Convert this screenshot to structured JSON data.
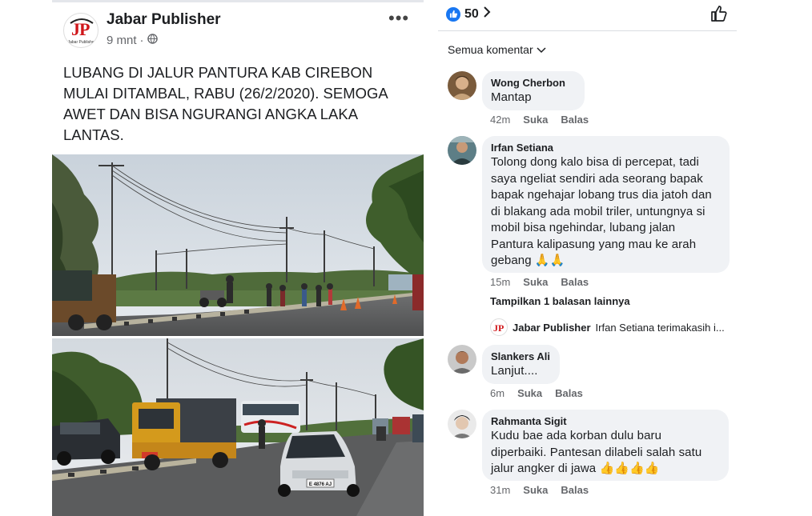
{
  "post": {
    "author": "Jabar Publisher",
    "time": "9 mnt",
    "logo_text": "JP",
    "logo_subtext": "Jabar Publisher",
    "privacy_icon": "globe-icon",
    "more_icon": "more-horizontal-icon",
    "text": "LUBANG DI JALUR PANTURA KAB CIREBON MULAI DITAMBAL, RABU (26/2/2020). SEMOGA AWET DAN BISA NGURANGI ANGKA LAKA LANTAS.",
    "photo2_plate": "E 4876 AJ"
  },
  "comments_panel": {
    "reaction_count": "50",
    "sort_label": "Semua komentar",
    "like_icon": "thumbs-up-icon",
    "accent": "#1877f2",
    "comments": [
      {
        "name": "Wong Cherbon",
        "text": "Mantap",
        "time": "42m",
        "like": "Suka",
        "reply": "Balas"
      },
      {
        "name": "Irfan Setiana",
        "text": "Tolong dong kalo bisa di percepat, tadi saya ngeliat sendiri ada seorang bapak bapak ngehajar lobang trus dia jatoh dan di blakang ada mobil triler, untungnya si mobil bisa ngehindar, lubang jalan Pantura kalipasung yang mau ke arah gebang 🙏🙏",
        "time": "15m",
        "like": "Suka",
        "reply": "Balas"
      },
      {
        "name": "Slankers Ali",
        "text": "Lanjut....",
        "time": "6m",
        "like": "Suka",
        "reply": "Balas"
      },
      {
        "name": "Rahmanta Sigit",
        "text": "Kudu bae ada korban dulu baru diperbaiki. Pantesan dilabeli salah satu jalur angker di jawa 👍👍👍👍",
        "time": "31m",
        "like": "Suka",
        "reply": "Balas"
      }
    ],
    "more_replies": "Tampilkan 1 balasan lainnya",
    "reply_preview": {
      "author": "Jabar Publisher",
      "text": "Irfan Setiana terimakasih i..."
    }
  }
}
